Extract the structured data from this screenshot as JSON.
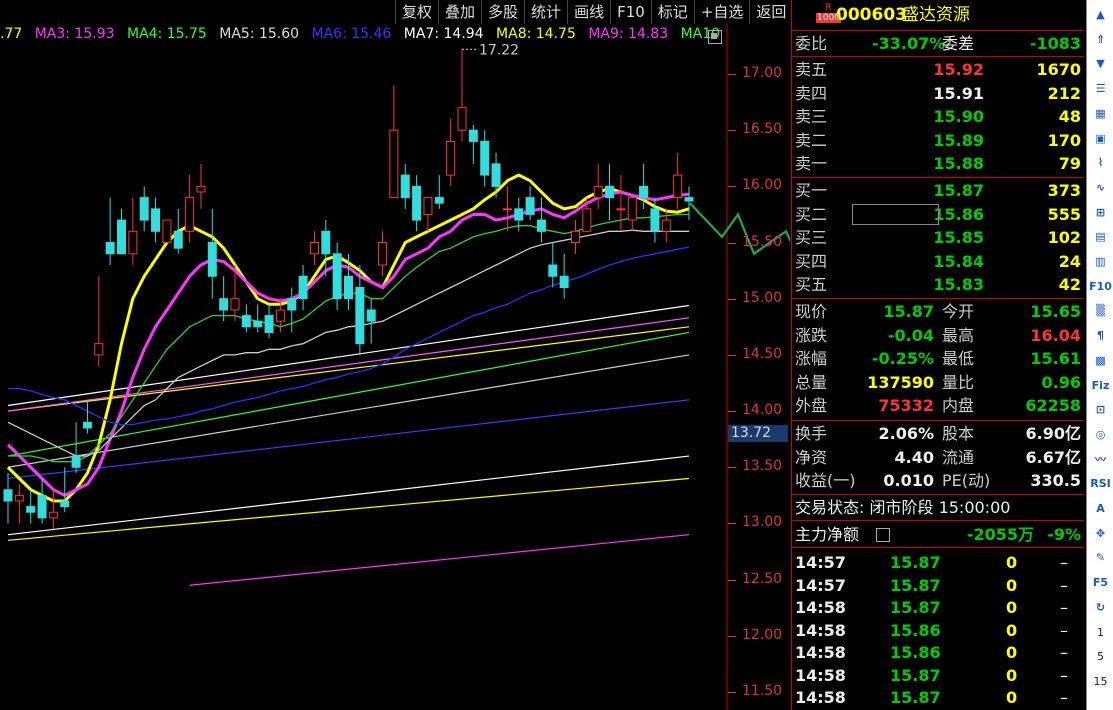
{
  "toolbar": [
    "复权",
    "叠加",
    "多股",
    "统计",
    "画线",
    "F10",
    "标记",
    "+自选",
    "返回"
  ],
  "ma_legend": [
    {
      "label": ".77",
      "color": "#ffff00"
    },
    {
      "label": "MA3: 15.93",
      "color": "#ff33ff"
    },
    {
      "label": "MA4: 15.75",
      "color": "#33ff33"
    },
    {
      "label": "MA5: 15.60",
      "color": "#dddddd"
    },
    {
      "label": "MA6: 15.46",
      "color": "#3333ff"
    },
    {
      "label": "MA7: 14.94",
      "color": "#ffffff"
    },
    {
      "label": "MA8: 14.75",
      "color": "#ffff00"
    },
    {
      "label": "MA9: 14.83",
      "color": "#ff33ff"
    },
    {
      "label": "MA10",
      "color": "#33ff33"
    }
  ],
  "price_axis": [
    "17.00",
    "16.50",
    "16.00",
    "15.50",
    "15.00",
    "14.50",
    "14.00",
    "13.50",
    "13.00",
    "12.50",
    "12.00",
    "11.50"
  ],
  "high_marker": "17.22",
  "current_price_tag": "13.72",
  "chart_data": {
    "type": "candlestick",
    "ylim": [
      11.5,
      17.3
    ],
    "candles": [
      [
        13.3,
        13.45,
        13.2,
        13.0
      ],
      [
        13.2,
        13.35,
        13.25,
        13.0
      ],
      [
        13.15,
        13.3,
        13.1,
        13.0
      ],
      [
        13.25,
        13.4,
        13.05,
        13.0
      ],
      [
        13.05,
        13.3,
        13.1,
        12.95
      ],
      [
        13.2,
        13.5,
        13.15,
        13.1
      ],
      [
        13.6,
        13.9,
        13.5,
        13.45
      ],
      [
        13.9,
        14.1,
        13.85,
        13.8
      ],
      [
        14.5,
        15.2,
        14.6,
        14.4
      ],
      [
        15.5,
        15.9,
        15.4,
        15.3
      ],
      [
        15.7,
        15.8,
        15.4,
        15.5
      ],
      [
        15.4,
        15.9,
        15.6,
        15.3
      ],
      [
        15.9,
        16.0,
        15.7,
        15.6
      ],
      [
        15.8,
        15.9,
        15.6,
        15.5
      ],
      [
        15.5,
        15.7,
        15.7,
        15.6
      ],
      [
        15.6,
        15.8,
        15.45,
        15.4
      ],
      [
        15.6,
        16.1,
        15.9,
        15.5
      ],
      [
        15.95,
        16.2,
        16.0,
        15.8
      ],
      [
        15.5,
        15.8,
        15.2,
        15.0
      ],
      [
        15.0,
        15.2,
        14.9,
        14.8
      ],
      [
        14.9,
        15.3,
        15.0,
        14.8
      ],
      [
        14.85,
        14.95,
        14.75,
        14.7
      ],
      [
        14.8,
        14.95,
        14.75,
        14.7
      ],
      [
        14.85,
        14.95,
        14.7,
        14.65
      ],
      [
        14.8,
        15.0,
        14.9,
        14.7
      ],
      [
        15.0,
        15.1,
        14.9,
        14.7
      ],
      [
        15.2,
        15.3,
        15.0,
        14.9
      ],
      [
        15.4,
        15.6,
        15.5,
        15.3
      ],
      [
        15.6,
        15.7,
        15.4,
        15.2
      ],
      [
        15.4,
        15.5,
        15.0,
        14.9
      ],
      [
        15.2,
        15.4,
        15.0,
        14.9
      ],
      [
        15.1,
        15.3,
        14.6,
        14.5
      ],
      [
        14.9,
        15.0,
        14.8,
        14.6
      ],
      [
        15.3,
        15.6,
        15.5,
        15.2
      ],
      [
        15.9,
        16.9,
        16.5,
        16.0
      ],
      [
        16.1,
        16.2,
        15.9,
        15.8
      ],
      [
        16.0,
        16.1,
        15.7,
        15.6
      ],
      [
        15.75,
        15.9,
        15.9,
        15.6
      ],
      [
        15.9,
        16.1,
        15.85,
        15.8
      ],
      [
        16.1,
        16.6,
        16.4,
        16.0
      ],
      [
        16.5,
        17.22,
        16.7,
        16.4
      ],
      [
        16.5,
        16.55,
        16.4,
        16.2
      ],
      [
        16.4,
        16.5,
        16.1,
        16.0
      ],
      [
        16.2,
        16.3,
        16.0,
        15.9
      ],
      [
        15.8,
        16.0,
        15.8,
        15.6
      ],
      [
        15.8,
        15.9,
        15.7,
        15.6
      ],
      [
        15.9,
        16.0,
        15.75,
        15.7
      ],
      [
        15.7,
        15.9,
        15.6,
        15.5
      ],
      [
        15.3,
        15.5,
        15.2,
        15.1
      ],
      [
        15.2,
        15.4,
        15.1,
        15.0
      ],
      [
        15.5,
        15.7,
        15.6,
        15.4
      ],
      [
        15.6,
        15.9,
        15.8,
        15.6
      ],
      [
        15.9,
        16.2,
        16.0,
        15.8
      ],
      [
        16.0,
        16.2,
        15.9,
        15.7
      ],
      [
        15.8,
        16.1,
        15.8,
        15.6
      ],
      [
        15.7,
        15.9,
        15.9,
        15.6
      ],
      [
        16.0,
        16.2,
        15.9,
        15.8
      ],
      [
        15.8,
        15.9,
        15.6,
        15.5
      ],
      [
        15.6,
        15.8,
        15.7,
        15.5
      ],
      [
        15.9,
        16.3,
        16.1,
        15.8
      ],
      [
        15.9,
        16.0,
        15.87,
        15.7
      ]
    ],
    "ma_lines": [
      {
        "color": "#ffff00",
        "width": 3,
        "values": [
          13.5,
          13.4,
          13.3,
          13.25,
          13.2,
          13.2,
          13.3,
          13.45,
          13.7,
          14.1,
          14.6,
          15.0,
          15.2,
          15.35,
          15.5,
          15.6,
          15.65,
          15.6,
          15.55,
          15.45,
          15.3,
          15.15,
          15.0,
          14.95,
          14.95,
          14.98,
          15.05,
          15.2,
          15.35,
          15.38,
          15.32,
          15.25,
          15.15,
          15.1,
          15.3,
          15.5,
          15.55,
          15.6,
          15.65,
          15.7,
          15.75,
          15.8,
          15.88,
          15.95,
          16.05,
          16.1,
          16.05,
          15.95,
          15.85,
          15.8,
          15.82,
          15.9,
          15.95,
          15.98,
          15.95,
          15.92,
          15.88,
          15.82,
          15.78,
          15.77,
          15.8
        ]
      },
      {
        "color": "#ff33ff",
        "width": 3,
        "values": [
          13.7,
          13.6,
          13.5,
          13.4,
          13.3,
          13.25,
          13.3,
          13.35,
          13.5,
          13.75,
          14.0,
          14.3,
          14.55,
          14.75,
          14.9,
          15.05,
          15.2,
          15.3,
          15.35,
          15.33,
          15.25,
          15.15,
          15.05,
          15.0,
          14.98,
          15.0,
          15.05,
          15.15,
          15.25,
          15.3,
          15.28,
          15.2,
          15.15,
          15.1,
          15.2,
          15.35,
          15.4,
          15.45,
          15.55,
          15.6,
          15.7,
          15.75,
          15.75,
          15.7,
          15.72,
          15.75,
          15.78,
          15.8,
          15.75,
          15.72,
          15.78,
          15.85,
          15.9,
          15.93,
          15.95,
          15.92,
          15.9,
          15.88,
          15.9,
          15.92,
          15.93
        ]
      },
      {
        "color": "#33cc33",
        "width": 1.3,
        "values": [
          13.6,
          13.6,
          13.6,
          13.58,
          13.55,
          13.55,
          13.55,
          13.6,
          13.7,
          13.8,
          13.95,
          14.1,
          14.25,
          14.4,
          14.55,
          14.65,
          14.75,
          14.8,
          14.85,
          14.85,
          14.85,
          14.82,
          14.8,
          14.78,
          14.75,
          14.78,
          14.82,
          14.9,
          14.98,
          15.02,
          15.05,
          15.05,
          15.0,
          15.0,
          15.1,
          15.2,
          15.28,
          15.35,
          15.42,
          15.45,
          15.5,
          15.55,
          15.58,
          15.6,
          15.63,
          15.65,
          15.65,
          15.62,
          15.6,
          15.58,
          15.6,
          15.63,
          15.66,
          15.68,
          15.7,
          15.72,
          15.72,
          15.73,
          15.74,
          15.75,
          15.75
        ]
      },
      {
        "color": "#cccccc",
        "width": 1.3,
        "values": [
          13.9,
          13.85,
          13.8,
          13.75,
          13.7,
          13.65,
          13.6,
          13.6,
          13.65,
          13.75,
          13.85,
          13.95,
          14.05,
          14.1,
          14.2,
          14.3,
          14.35,
          14.4,
          14.45,
          14.5,
          14.5,
          14.52,
          14.52,
          14.55,
          14.55,
          14.58,
          14.6,
          14.65,
          14.7,
          14.72,
          14.75,
          14.76,
          14.78,
          14.8,
          14.85,
          14.9,
          14.95,
          15.0,
          15.05,
          15.1,
          15.15,
          15.2,
          15.25,
          15.3,
          15.35,
          15.4,
          15.45,
          15.48,
          15.5,
          15.52,
          15.54,
          15.56,
          15.58,
          15.6,
          15.6,
          15.61,
          15.6,
          15.6,
          15.6,
          15.6,
          15.6
        ]
      },
      {
        "color": "#2233ff",
        "width": 1.3,
        "values": [
          14.2,
          14.2,
          14.18,
          14.15,
          14.12,
          14.1,
          14.05,
          14.0,
          13.95,
          13.9,
          13.88,
          13.88,
          13.9,
          13.92,
          13.93,
          13.95,
          13.97,
          14.0,
          14.02,
          14.05,
          14.08,
          14.1,
          14.12,
          14.15,
          14.18,
          14.2,
          14.22,
          14.25,
          14.28,
          14.3,
          14.33,
          14.35,
          14.38,
          14.42,
          14.48,
          14.55,
          14.6,
          14.65,
          14.7,
          14.75,
          14.8,
          14.85,
          14.88,
          14.92,
          14.95,
          15.0,
          15.05,
          15.08,
          15.12,
          15.15,
          15.18,
          15.22,
          15.26,
          15.3,
          15.33,
          15.36,
          15.38,
          15.4,
          15.42,
          15.44,
          15.46
        ]
      }
    ],
    "straight_ma": [
      {
        "color": "#ffffff",
        "from": [
          0,
          14.05
        ],
        "to": [
          60,
          14.94
        ]
      },
      {
        "color": "#ffff00",
        "from": [
          0,
          14.0
        ],
        "to": [
          60,
          14.75
        ]
      },
      {
        "color": "#ff55ff",
        "from": [
          0,
          14.0
        ],
        "to": [
          60,
          14.83
        ]
      },
      {
        "color": "#33ff33",
        "from": [
          0,
          13.6
        ],
        "to": [
          60,
          14.7
        ]
      },
      {
        "color": "#cccccc",
        "from": [
          0,
          13.5
        ],
        "to": [
          60,
          14.5
        ]
      },
      {
        "color": "#2244ff",
        "from": [
          0,
          13.4
        ],
        "to": [
          60,
          14.1
        ]
      },
      {
        "color": "#ffffff",
        "from": [
          0,
          12.9
        ],
        "to": [
          60,
          13.6
        ]
      },
      {
        "color": "#ffff00",
        "from": [
          0,
          12.85
        ],
        "to": [
          60,
          13.4
        ]
      },
      {
        "color": "#ff33ff",
        "from": [
          16,
          12.45
        ],
        "to": [
          60,
          12.9
        ]
      }
    ],
    "projection": [
      [
        0,
        15.85
      ],
      [
        1,
        15.7
      ],
      [
        2,
        15.55
      ],
      [
        3,
        15.75
      ],
      [
        4,
        15.4
      ],
      [
        5,
        15.5
      ],
      [
        6,
        15.6
      ],
      [
        7,
        15.3
      ],
      [
        8,
        14.75
      ],
      [
        9,
        15.0
      ],
      [
        10,
        14.5
      ],
      [
        11,
        14.35
      ],
      [
        12,
        14.55
      ],
      [
        13,
        13.65
      ]
    ]
  },
  "panel": {
    "stock_code": "000603",
    "stock_name": "盛达资源",
    "badge": "R 1000",
    "weibi_label": "委比",
    "weibi_value": "-33.07%",
    "weicha_label": "委差",
    "weicha_value": "-1083",
    "sell": [
      {
        "label": "卖五",
        "price": "15.92",
        "vol": "1670",
        "cls": "r"
      },
      {
        "label": "卖四",
        "price": "15.91",
        "vol": "212",
        "cls": "w"
      },
      {
        "label": "卖三",
        "price": "15.90",
        "vol": "48",
        "cls": "g"
      },
      {
        "label": "卖二",
        "price": "15.89",
        "vol": "170",
        "cls": "g"
      },
      {
        "label": "卖一",
        "price": "15.88",
        "vol": "79",
        "cls": "g"
      }
    ],
    "buy": [
      {
        "label": "买一",
        "price": "15.87",
        "vol": "373",
        "cls": "g"
      },
      {
        "label": "买二",
        "price": "15.86",
        "vol": "555",
        "cls": "g"
      },
      {
        "label": "买三",
        "price": "15.85",
        "vol": "102",
        "cls": "g"
      },
      {
        "label": "买四",
        "price": "15.84",
        "vol": "24",
        "cls": "g"
      },
      {
        "label": "买五",
        "price": "15.83",
        "vol": "42",
        "cls": "g"
      }
    ],
    "quote": [
      {
        "l1": "现价",
        "v1": "15.87",
        "c1": "g",
        "l2": "今开",
        "v2": "15.65",
        "c2": "g"
      },
      {
        "l1": "涨跌",
        "v1": "-0.04",
        "c1": "g",
        "l2": "最高",
        "v2": "16.04",
        "c2": "r"
      },
      {
        "l1": "涨幅",
        "v1": "-0.25%",
        "c1": "g",
        "l2": "最低",
        "v2": "15.61",
        "c2": "g"
      },
      {
        "l1": "总量",
        "v1": "137590",
        "c1": "y",
        "l2": "量比",
        "v2": "0.96",
        "c2": "g"
      },
      {
        "l1": "外盘",
        "v1": "75332",
        "c1": "r",
        "l2": "内盘",
        "v2": "62258",
        "c2": "g"
      }
    ],
    "fund": [
      {
        "l1": "换手",
        "v1": "2.06%",
        "l2": "股本",
        "v2": "6.90亿"
      },
      {
        "l1": "净资",
        "v1": "4.40",
        "l2": "流通",
        "v2": "6.67亿"
      },
      {
        "l1": "收益(一)",
        "v1": "0.010",
        "l2": "PE(动)",
        "v2": "330.5"
      }
    ],
    "trade_status_label": "交易状态: 闭市阶段 15:00:00",
    "main_flow_label": "主力净额",
    "main_flow_value": "-2055万",
    "main_flow_pct": "-9%",
    "ticks": [
      {
        "time": "14:57",
        "price": "15.87",
        "vol": "0",
        "dir": "–"
      },
      {
        "time": "14:57",
        "price": "15.87",
        "vol": "0",
        "dir": "–"
      },
      {
        "time": "14:58",
        "price": "15.87",
        "vol": "0",
        "dir": "–"
      },
      {
        "time": "14:58",
        "price": "15.86",
        "vol": "0",
        "dir": "–"
      },
      {
        "time": "14:58",
        "price": "15.86",
        "vol": "0",
        "dir": "–"
      },
      {
        "time": "14:58",
        "price": "15.87",
        "vol": "0",
        "dir": "–"
      },
      {
        "time": "14:58",
        "price": "15.87",
        "vol": "0",
        "dir": "–"
      }
    ]
  },
  "sidebar": {
    "buttons": [
      "up-arrow",
      "double-up-arrow",
      "down-arrow",
      "list",
      "grid",
      "chart",
      "minute",
      "line",
      "candle",
      "table",
      "list2",
      "F10",
      "tech",
      "text",
      "F",
      "F2",
      "zoom",
      "target",
      "wave",
      "RSI",
      "text-a",
      "move",
      "pen",
      "F5",
      "refresh",
      "1",
      "5",
      "15"
    ],
    "labels": {
      "f10": "F10",
      "rsi": "RSI",
      "f5": "F5",
      "n1": "1",
      "n5": "5",
      "n15": "15"
    }
  }
}
